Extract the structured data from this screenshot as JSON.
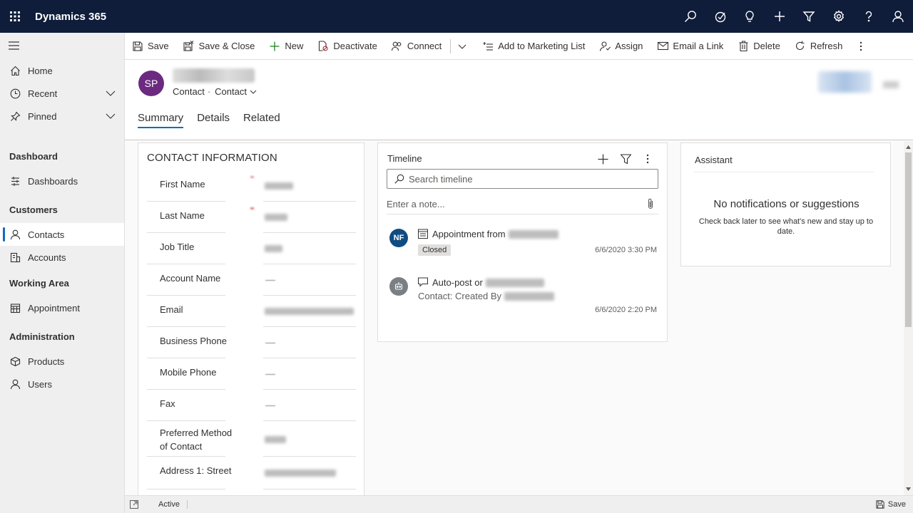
{
  "app": {
    "title": "Dynamics 365"
  },
  "topbar_icons": [
    "search-icon",
    "task-icon",
    "lightbulb-icon",
    "plus-icon",
    "filter-icon",
    "settings-icon",
    "help-icon",
    "user-icon"
  ],
  "sidebar": {
    "items": [
      {
        "label": "Home",
        "icon": "home-icon"
      },
      {
        "label": "Recent",
        "icon": "clock-icon"
      },
      {
        "label": "Pinned",
        "icon": "pin-icon"
      }
    ],
    "sections": [
      {
        "title": "Dashboard",
        "items": [
          {
            "label": "Dashboards",
            "icon": "dashboard-icon"
          }
        ]
      },
      {
        "title": "Customers",
        "items": [
          {
            "label": "Contacts",
            "icon": "person-icon",
            "active": true
          },
          {
            "label": "Accounts",
            "icon": "accounts-icon"
          }
        ]
      },
      {
        "title": "Working Area",
        "items": [
          {
            "label": "Appointment",
            "icon": "calendar-icon"
          }
        ]
      },
      {
        "title": "Administration",
        "items": [
          {
            "label": "Products",
            "icon": "box-icon"
          },
          {
            "label": "Users",
            "icon": "person-icon"
          }
        ]
      }
    ]
  },
  "commands": {
    "save": "Save",
    "save_close": "Save & Close",
    "new": "New",
    "deactivate": "Deactivate",
    "connect": "Connect",
    "add_marketing": "Add to Marketing List",
    "assign": "Assign",
    "email_link": "Email a Link",
    "delete": "Delete",
    "refresh": "Refresh"
  },
  "record": {
    "initials": "SP",
    "entity": "Contact",
    "form": "Contact",
    "avatar_color": "#6b2a80"
  },
  "tabs": [
    "Summary",
    "Details",
    "Related"
  ],
  "contact_info": {
    "title": "CONTACT INFORMATION",
    "fields": [
      {
        "label": "First Name",
        "required": true
      },
      {
        "label": "Last Name",
        "required": true
      },
      {
        "label": "Job Title"
      },
      {
        "label": "Account Name"
      },
      {
        "label": "Email"
      },
      {
        "label": "Business Phone"
      },
      {
        "label": "Mobile Phone"
      },
      {
        "label": "Fax"
      },
      {
        "label": "Preferred Method of Contact"
      },
      {
        "label": "Address 1: Street"
      }
    ]
  },
  "timeline": {
    "title": "Timeline",
    "search_placeholder": "Search timeline",
    "note_placeholder": "Enter a note...",
    "entries": [
      {
        "avatar": "NF",
        "avatar_color": "#0f4c81",
        "head": "Appointment from",
        "badge": "Closed",
        "date": "6/6/2020 3:30 PM"
      },
      {
        "avatar": "",
        "avatar_color": "#7a7f84",
        "head": "Auto-post or",
        "sub": "Contact: Created By",
        "date": "6/6/2020 2:20 PM"
      }
    ]
  },
  "assistant": {
    "title": "Assistant",
    "main": "No notifications or suggestions",
    "sub": "Check back later to see what's new and stay up to date."
  },
  "status": {
    "state": "Active",
    "save": "Save"
  },
  "colors": {
    "topbar": "#0f1c3a",
    "accent": "#0f6cbd"
  }
}
